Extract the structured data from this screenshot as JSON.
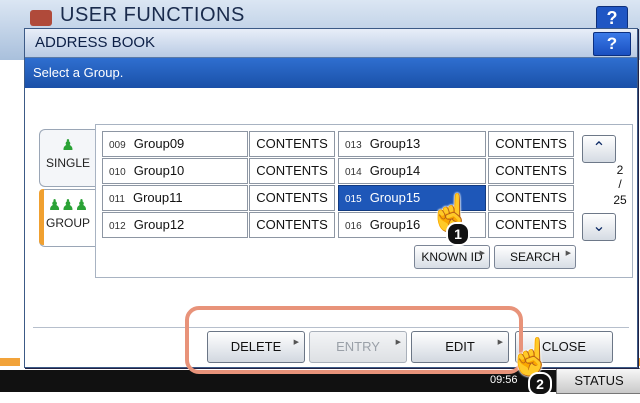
{
  "background": {
    "title": "USER FUNCTIONS",
    "help_label": "?",
    "status_label": "STATUS",
    "time": "09:56"
  },
  "dialog": {
    "title": "ADDRESS BOOK",
    "help_label": "?",
    "message": "Select a Group."
  },
  "side_tabs": [
    {
      "label": "SINGLE",
      "icon": "person-icon",
      "selected": false
    },
    {
      "label": "GROUP",
      "icon": "group-icon",
      "selected": true
    }
  ],
  "groups_left": [
    {
      "num": "009",
      "name": "Group09",
      "contents": "CONTENTS"
    },
    {
      "num": "010",
      "name": "Group10",
      "contents": "CONTENTS"
    },
    {
      "num": "011",
      "name": "Group11",
      "contents": "CONTENTS"
    },
    {
      "num": "012",
      "name": "Group12",
      "contents": "CONTENTS"
    }
  ],
  "groups_right": [
    {
      "num": "013",
      "name": "Group13",
      "contents": "CONTENTS"
    },
    {
      "num": "014",
      "name": "Group14",
      "contents": "CONTENTS"
    },
    {
      "num": "015",
      "name": "Group15",
      "contents": "CONTENTS",
      "selected": true
    },
    {
      "num": "016",
      "name": "Group16",
      "contents": "CONTENTS"
    }
  ],
  "pagination": {
    "current": "2",
    "separator": "/",
    "total": "25"
  },
  "buttons": {
    "known_id": "KNOWN ID",
    "search": "SEARCH",
    "delete": "DELETE",
    "entry": "ENTRY",
    "edit": "EDIT",
    "close": "CLOSE"
  },
  "annotations": {
    "step1": "1",
    "step2": "2",
    "highlight_color": "#e8937a"
  }
}
